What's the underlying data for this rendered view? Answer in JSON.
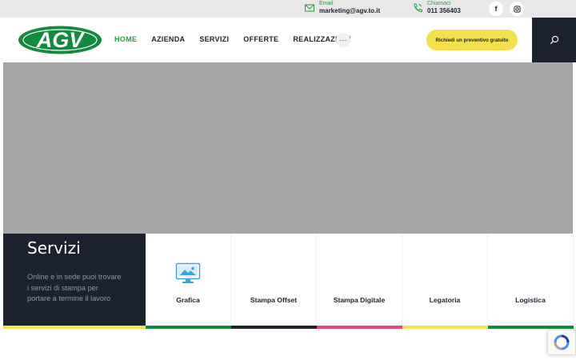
{
  "topbar": {
    "email": {
      "label": "Email",
      "value": "marketing@agv.to.it",
      "icon": "mail-icon"
    },
    "phone": {
      "label": "Chiamaci",
      "value": "011 356403",
      "icon": "phone-icon"
    },
    "social": [
      {
        "glyph": "f",
        "icon": "facebook-icon"
      },
      {
        "glyph": "◎",
        "icon": "instagram-icon"
      }
    ]
  },
  "header": {
    "logo_text": "AGV",
    "nav": [
      {
        "label": "HOME",
        "active": true
      },
      {
        "label": "AZIENDA",
        "active": false
      },
      {
        "label": "SERVIZI",
        "active": false
      },
      {
        "label": "OFFERTE",
        "active": false
      },
      {
        "label": "REALIZZAZIONI",
        "active": false
      }
    ],
    "more_label": "···",
    "cta_label": "Richiedi un preventivo gratuito",
    "search_icon": "search-icon"
  },
  "services": {
    "title": "Servizi",
    "description": "Online e in sede puoi trovare i servizi di stampa per portare a termine il lavoro",
    "cards": [
      {
        "label": "Grafica",
        "icon": "monitor-image-icon",
        "stripe_color": "#138a3d"
      },
      {
        "label": "Stampa Offset",
        "icon": "",
        "stripe_color": "#1c2230"
      },
      {
        "label": "Stampa Digitale",
        "icon": "",
        "stripe_color": "#e6457a"
      },
      {
        "label": "Legatoria",
        "icon": "",
        "stripe_color": "#f4e04d"
      },
      {
        "label": "Logistica",
        "icon": "",
        "stripe_color": "#138a3d"
      }
    ],
    "intro_stripe_color": "#f4e04d"
  },
  "colors": {
    "brand_green": "#2e9a46",
    "navy": "#1c2230",
    "yellow": "#f4e04d",
    "pink": "#e6457a"
  }
}
